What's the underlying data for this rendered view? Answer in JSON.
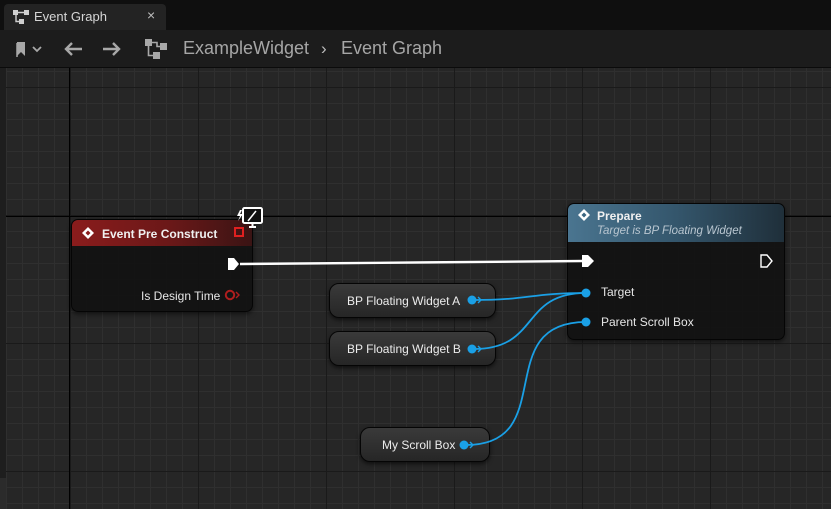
{
  "tab": {
    "label": "Event Graph",
    "close": "×",
    "icon": "graph-icon"
  },
  "toolbar": {
    "bookmark_icon": "bookmark-icon",
    "back_icon": "arrow-left-icon",
    "forward_icon": "arrow-right-icon",
    "breadcrumb": [
      "ExampleWidget",
      "Event Graph"
    ],
    "separator": "›"
  },
  "nodes": {
    "event": {
      "title": "Event Pre Construct",
      "pins": {
        "is_design_time": "Is Design Time"
      },
      "color": "#8a1c1c"
    },
    "prepare": {
      "title": "Prepare",
      "subtitle": "Target is BP Floating Widget",
      "pins": {
        "target": "Target",
        "parent_scroll_box": "Parent Scroll Box"
      },
      "color": "#4a7590"
    },
    "vars": [
      {
        "label": "BP Floating Widget A"
      },
      {
        "label": "BP Floating Widget B"
      },
      {
        "label": "My Scroll Box"
      }
    ]
  },
  "colors": {
    "object_pin": "#1aa0e6",
    "bool_pin": "#9a1c1c",
    "exec_pin": "#ffffff",
    "background": "#262626"
  }
}
